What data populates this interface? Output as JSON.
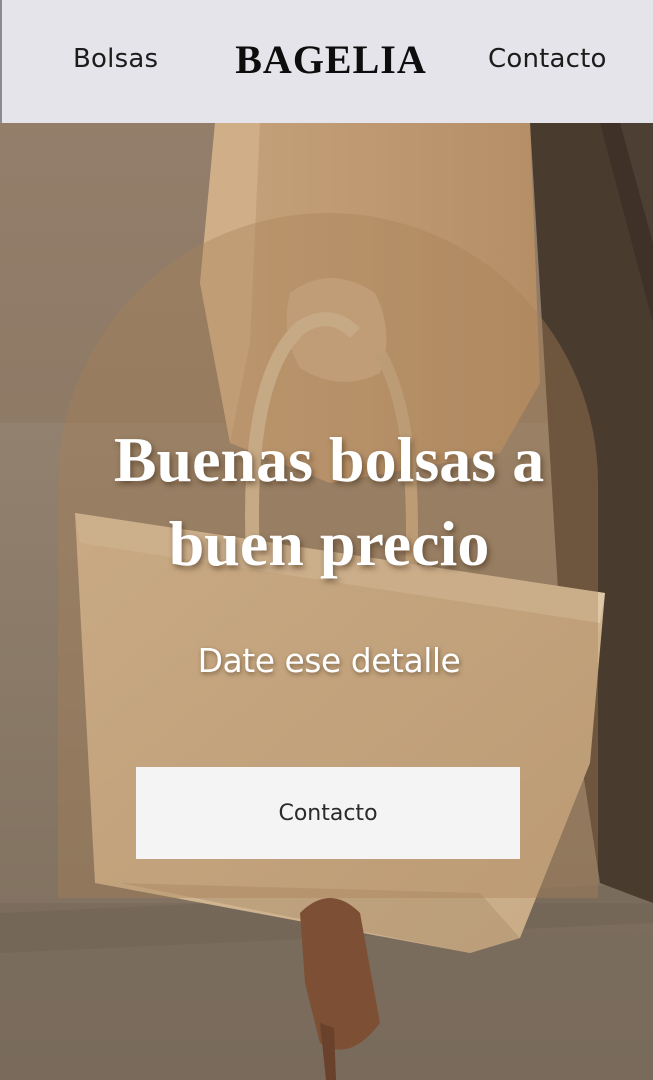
{
  "header": {
    "nav_left": "Bolsas",
    "logo": "BAGELIA",
    "nav_right": "Contacto"
  },
  "hero": {
    "headline": "Buenas bolsas a buen precio",
    "subline": "Date ese detalle",
    "cta_label": "Contacto"
  },
  "colors": {
    "header_bg": "#e4e4ea",
    "hero_tint": "#a88258",
    "cta_bg": "#f4f4f4"
  }
}
